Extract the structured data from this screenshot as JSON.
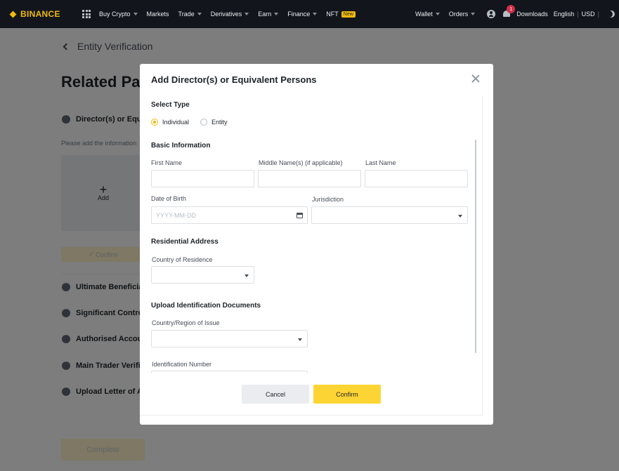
{
  "nav": {
    "logo": "BINANCE",
    "items": [
      {
        "label": "Buy Crypto",
        "caret": true
      },
      {
        "label": "Markets",
        "caret": false
      },
      {
        "label": "Trade",
        "caret": true
      },
      {
        "label": "Derivatives",
        "caret": true
      },
      {
        "label": "Earn",
        "caret": true
      },
      {
        "label": "Finance",
        "caret": true
      },
      {
        "label": "NFT",
        "caret": false,
        "badge": "New"
      }
    ],
    "wallet": "Wallet",
    "orders": "Orders",
    "notification_count": "1",
    "downloads": "Downloads",
    "language": "English",
    "currency": "USD",
    "separator": "|"
  },
  "page": {
    "back_label": "Entity Verification",
    "title": "Related Par",
    "hint": "Please add the information",
    "add_label": "Add",
    "confirm_label": "Confirm",
    "complete_label": "Complete",
    "sections": [
      "Director(s) or Equiv",
      "Ultimate Beneficia",
      "Significant Control",
      "Authorised Accoun",
      "Main Trader Verifi",
      "Upload Letter of Au"
    ]
  },
  "modal": {
    "title": "Add Director(s) or Equivalent Persons",
    "select_type": "Select Type",
    "type_options": [
      "Individual",
      "Entity"
    ],
    "selected_type": "Individual",
    "basic_info": "Basic Information",
    "first_name": "First Name",
    "middle_name": "Middle Name(s) (if applicable)",
    "last_name": "Last Name",
    "dob": "Date of Birth",
    "dob_placeholder": "YYYY-MM-DD",
    "jurisdiction": "Jurisdiction",
    "residential_address": "Residential Address",
    "country_of_residence": "Country of Residence",
    "upload_docs": "Upload Identification Documents",
    "country_region_issue": "Country/Region of Issue",
    "id_number": "Identification Number",
    "cancel": "Cancel",
    "confirm": "Confirm"
  },
  "colors": {
    "brand": "#F0B90B",
    "confirm_button": "#FCD535",
    "nav_bg": "#12161C"
  }
}
